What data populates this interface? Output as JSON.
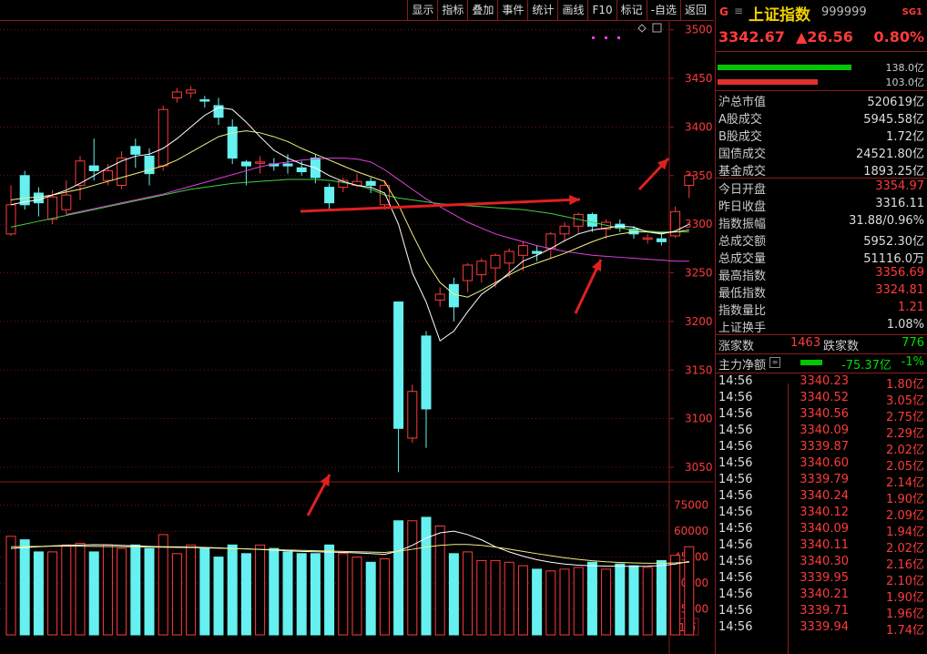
{
  "colors": {
    "up": "#ff3b3b",
    "down": "#66f0f0",
    "ma5": "#ffffff",
    "ma10": "#f0f080",
    "ma20": "#e040e0",
    "ma60": "#40d040",
    "grid": "#8a1b1b",
    "annotation": "#e02020"
  },
  "toolbar": {
    "buttons": [
      "显示",
      "指标",
      "叠加",
      "事件",
      "统计",
      "画线",
      "F10",
      "标记",
      "-自选",
      "返回"
    ]
  },
  "price_axis": {
    "labels": [
      "3500",
      "3450",
      "3400",
      "3350",
      "3300",
      "3250",
      "3200",
      "3150",
      "3100",
      "3050"
    ]
  },
  "volume_axis": {
    "labels": [
      "75000",
      "60000",
      "45000",
      "30000",
      "15000"
    ],
    "unit": "X1万"
  },
  "chart_data": {
    "type": "candlestick",
    "ylim": [
      3035,
      3510
    ],
    "candles": [
      [
        3290,
        3320,
        3288,
        3340
      ],
      [
        3350,
        3320,
        3315,
        3355
      ],
      [
        3332,
        3322,
        3308,
        3338
      ],
      [
        3305,
        3328,
        3300,
        3335
      ],
      [
        3315,
        3330,
        3310,
        3345
      ],
      [
        3340,
        3365,
        3325,
        3370
      ],
      [
        3360,
        3355,
        3345,
        3388
      ],
      [
        3345,
        3355,
        3340,
        3362
      ],
      [
        3340,
        3368,
        3336,
        3375
      ],
      [
        3380,
        3372,
        3358,
        3388
      ],
      [
        3370,
        3352,
        3340,
        3378
      ],
      [
        3360,
        3418,
        3355,
        3422
      ],
      [
        3430,
        3436,
        3425,
        3440
      ],
      [
        3435,
        3438,
        3430,
        3442
      ],
      [
        3428,
        3427,
        3420,
        3432
      ],
      [
        3422,
        3410,
        3402,
        3430
      ],
      [
        3400,
        3368,
        3362,
        3408
      ],
      [
        3364,
        3360,
        3340,
        3366
      ],
      [
        3364,
        3364,
        3352,
        3370
      ],
      [
        3362,
        3360,
        3355,
        3368
      ],
      [
        3362,
        3360,
        3352,
        3372
      ],
      [
        3358,
        3354,
        3350,
        3365
      ],
      [
        3368,
        3348,
        3342,
        3372
      ],
      [
        3338,
        3322,
        3315,
        3342
      ],
      [
        3338,
        3345,
        3333,
        3348
      ],
      [
        3340,
        3344,
        3338,
        3352
      ],
      [
        3344,
        3340,
        3332,
        3348
      ],
      [
        3320,
        3340,
        3315,
        3345
      ],
      [
        3220,
        3090,
        3045,
        3218
      ],
      [
        3080,
        3128,
        3075,
        3135
      ],
      [
        3185,
        3110,
        3070,
        3190
      ],
      [
        3222,
        3228,
        3215,
        3235
      ],
      [
        3238,
        3215,
        3200,
        3245
      ],
      [
        3242,
        3258,
        3230,
        3260
      ],
      [
        3248,
        3262,
        3240,
        3265
      ],
      [
        3255,
        3268,
        3235,
        3270
      ],
      [
        3260,
        3272,
        3245,
        3275
      ],
      [
        3268,
        3278,
        3252,
        3282
      ],
      [
        3272,
        3270,
        3262,
        3278
      ],
      [
        3275,
        3290,
        3265,
        3292
      ],
      [
        3290,
        3298,
        3282,
        3302
      ],
      [
        3298,
        3310,
        3290,
        3312
      ],
      [
        3310,
        3298,
        3292,
        3312
      ],
      [
        3295,
        3302,
        3285,
        3305
      ],
      [
        3300,
        3296,
        3292,
        3305
      ],
      [
        3295,
        3290,
        3285,
        3298
      ],
      [
        3285,
        3286,
        3280,
        3290
      ],
      [
        3285,
        3282,
        3278,
        3292
      ],
      [
        3288,
        3313,
        3286,
        3318
      ],
      [
        3340,
        3350,
        3327,
        3352
      ]
    ],
    "ma5": [
      3320,
      3323,
      3325,
      3330,
      3335,
      3342,
      3350,
      3358,
      3365,
      3370,
      3372,
      3378,
      3388,
      3400,
      3412,
      3420,
      3418,
      3405,
      3390,
      3376,
      3368,
      3362,
      3358,
      3350,
      3344,
      3340,
      3338,
      3332,
      3300,
      3250,
      3220,
      3180,
      3190,
      3210,
      3228,
      3238,
      3250,
      3262,
      3268,
      3275,
      3283,
      3290,
      3294,
      3296,
      3298,
      3297,
      3292,
      3290,
      3293,
      3300
    ],
    "ma10": [
      3325,
      3327,
      3328,
      3330,
      3333,
      3336,
      3340,
      3344,
      3348,
      3352,
      3356,
      3360,
      3366,
      3374,
      3382,
      3390,
      3394,
      3396,
      3394,
      3390,
      3385,
      3378,
      3372,
      3366,
      3360,
      3354,
      3349,
      3344,
      3320,
      3290,
      3262,
      3240,
      3228,
      3225,
      3232,
      3240,
      3248,
      3255,
      3260,
      3265,
      3270,
      3276,
      3282,
      3287,
      3290,
      3292,
      3292,
      3291,
      3292,
      3294
    ],
    "ma20": [
      3310,
      3313,
      3316,
      3319,
      3322,
      3325,
      3328,
      3331,
      3335,
      3339,
      3343,
      3347,
      3351,
      3355,
      3359,
      3362,
      3364,
      3366,
      3367,
      3368,
      3368,
      3367,
      3364,
      3356,
      3346,
      3336,
      3326,
      3318,
      3310,
      3302,
      3296,
      3290,
      3286,
      3282,
      3278,
      3275,
      3272,
      3270,
      3268,
      3267,
      3266,
      3265,
      3264,
      3263,
      3262,
      3262
    ],
    "ma60": [
      3297,
      3300,
      3303,
      3306,
      3309,
      3312,
      3315,
      3318,
      3321,
      3324,
      3327,
      3330,
      3333,
      3336,
      3338,
      3340,
      3342,
      3343,
      3344,
      3345,
      3346,
      3346,
      3346,
      3345,
      3343,
      3340,
      3336,
      3330,
      3327,
      3325,
      3323,
      3321,
      3320,
      3319,
      3318,
      3317,
      3316,
      3315,
      3313,
      3311,
      3308,
      3305,
      3302,
      3299,
      3296,
      3294,
      3293,
      3292,
      3292,
      3292
    ],
    "volume": {
      "ylim": [
        0,
        88000
      ],
      "values": [
        57000,
        55000,
        48000,
        48000,
        52000,
        53000,
        48000,
        52000,
        50000,
        52000,
        50000,
        58000,
        47000,
        52000,
        50000,
        45000,
        52000,
        47000,
        52000,
        50000,
        48000,
        47000,
        47000,
        52000,
        47000,
        45000,
        42000,
        44000,
        66000,
        66000,
        68000,
        63000,
        47000,
        48000,
        43000,
        43000,
        42000,
        40000,
        38000,
        37000,
        38000,
        39000,
        42000,
        38000,
        41000,
        40000,
        39000,
        43000,
        46000,
        51000
      ],
      "ma_a": [
        50000,
        50500,
        51000,
        51500,
        51800,
        52000,
        52200,
        52100,
        51800,
        51500,
        51200,
        51000,
        50900,
        50800,
        50600,
        50300,
        50000,
        49700,
        49400,
        49000,
        48600,
        48300,
        48100,
        47900,
        47700,
        47400,
        47000,
        46600,
        48500,
        51800,
        56000,
        59000,
        60000,
        58000,
        55000,
        51000,
        48000,
        45500,
        43500,
        42000,
        41000,
        40300,
        40000,
        39800,
        39700,
        39600,
        39700,
        40100,
        41000,
        42500
      ],
      "ma_b": [
        51000,
        51100,
        51200,
        51300,
        51300,
        51300,
        51200,
        51100,
        51000,
        50900,
        50800,
        50700,
        50600,
        50500,
        50300,
        50100,
        49900,
        49700,
        49500,
        49300,
        49100,
        48900,
        48700,
        48500,
        48300,
        48100,
        47900,
        47700,
        48400,
        49500,
        50800,
        51800,
        52300,
        52300,
        51800,
        50800,
        49600,
        48300,
        47000,
        45800,
        44600,
        43700,
        42900,
        42300,
        41900,
        41600,
        41400,
        41400,
        41600,
        42000
      ]
    }
  },
  "info": {
    "flag": "G",
    "menu_icon": "≡",
    "name": "上证指数",
    "code": "999999",
    "tag": "SG1",
    "price": "3342.67",
    "change": "▲26.56",
    "pct": "0.80%",
    "buy_total": "138.0亿",
    "sell_total": "103.0亿",
    "buy_ratio": 0.98,
    "sell_ratio": 0.73,
    "rows": [
      {
        "label": "沪总市值",
        "value": "520619亿",
        "color": "white"
      },
      {
        "label": "A股成交",
        "value": "5945.58亿",
        "color": "white"
      },
      {
        "label": "B股成交",
        "value": "1.72亿",
        "color": "white"
      },
      {
        "label": "国债成交",
        "value": "24521.80亿",
        "color": "white"
      },
      {
        "label": "基金成交",
        "value": "1893.25亿",
        "color": "white"
      },
      {
        "label": "今日开盘",
        "value": "3354.97",
        "color": "red"
      },
      {
        "label": "昨日收盘",
        "value": "3316.11",
        "color": "white"
      },
      {
        "label": "指数振幅",
        "value": "31.88/0.96%",
        "color": "white"
      },
      {
        "label": "总成交额",
        "value": "5952.30亿",
        "color": "white"
      },
      {
        "label": "总成交量",
        "value": "51116.0万",
        "color": "white"
      },
      {
        "label": "最高指数",
        "value": "3356.69",
        "color": "red"
      },
      {
        "label": "最低指数",
        "value": "3324.81",
        "color": "red"
      },
      {
        "label": "指数量比",
        "value": "1.21",
        "color": "red"
      },
      {
        "label": "上证换手",
        "value": "1.08%",
        "color": "white"
      }
    ],
    "up_label": "涨家数",
    "up_count": "1463",
    "down_label": "跌家数",
    "down_count": "776",
    "flow_label": "主力净额",
    "flow_value": "-75.37亿",
    "flow_pct": "-1%"
  },
  "ticks": [
    {
      "time": "14:56",
      "price": "3340.23",
      "vol": "1.80亿"
    },
    {
      "time": "14:56",
      "price": "3340.52",
      "vol": "3.05亿"
    },
    {
      "time": "14:56",
      "price": "3340.56",
      "vol": "2.75亿"
    },
    {
      "time": "14:56",
      "price": "3340.09",
      "vol": "2.29亿"
    },
    {
      "time": "14:56",
      "price": "3339.87",
      "vol": "2.02亿"
    },
    {
      "time": "14:56",
      "price": "3340.60",
      "vol": "2.05亿"
    },
    {
      "time": "14:56",
      "price": "3339.79",
      "vol": "2.14亿"
    },
    {
      "time": "14:56",
      "price": "3340.24",
      "vol": "1.90亿"
    },
    {
      "time": "14:56",
      "price": "3340.12",
      "vol": "2.09亿"
    },
    {
      "time": "14:56",
      "price": "3340.09",
      "vol": "1.94亿"
    },
    {
      "time": "14:56",
      "price": "3340.11",
      "vol": "2.02亿"
    },
    {
      "time": "14:56",
      "price": "3340.30",
      "vol": "2.16亿"
    },
    {
      "time": "14:56",
      "price": "3339.95",
      "vol": "2.10亿"
    },
    {
      "time": "14:56",
      "price": "3340.21",
      "vol": "1.90亿"
    },
    {
      "time": "14:56",
      "price": "3339.71",
      "vol": "1.96亿"
    },
    {
      "time": "14:56",
      "price": "3339.94",
      "vol": "1.74亿"
    }
  ]
}
